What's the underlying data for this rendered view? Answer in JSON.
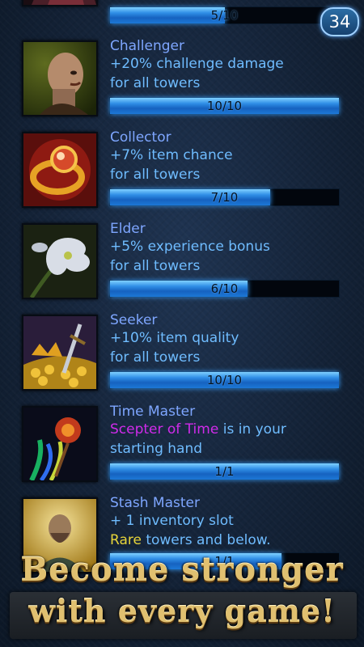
{
  "level_badge": "34",
  "talents": [
    {
      "id": "previous",
      "icon": "dark-tower-icon",
      "progress": {
        "label": "5/10",
        "current": 5,
        "max": 10
      }
    },
    {
      "id": "challenger",
      "icon": "bald-warrior-portrait-icon",
      "name": "Challenger",
      "desc": [
        "+20% challenge damage",
        "for all towers"
      ],
      "progress": {
        "label": "10/10",
        "current": 10,
        "max": 10
      }
    },
    {
      "id": "collector",
      "icon": "gold-ring-icon",
      "name": "Collector",
      "desc": [
        "+7% item chance",
        "for all towers"
      ],
      "progress": {
        "label": "7/10",
        "current": 7,
        "max": 10
      }
    },
    {
      "id": "elder",
      "icon": "white-flowers-icon",
      "name": "Elder",
      "desc": [
        "+5% experience bonus",
        "for all towers"
      ],
      "progress": {
        "label": "6/10",
        "current": 6,
        "max": 10
      }
    },
    {
      "id": "seeker",
      "icon": "treasure-sword-icon",
      "name": "Seeker",
      "desc": [
        "+10% item quality",
        "for all towers"
      ],
      "progress": {
        "label": "10/10",
        "current": 10,
        "max": 10
      }
    },
    {
      "id": "time_master",
      "icon": "scepter-icon",
      "name": "Time Master",
      "desc_highlight": "Scepter of Time",
      "desc_rest": " is in your",
      "desc_line2": "starting hand",
      "progress": {
        "label": "1/1",
        "current": 1,
        "max": 1
      }
    },
    {
      "id": "stash_master",
      "icon": "bearded-merchant-portrait-icon",
      "name": "Stash Master",
      "desc_line1": "+ 1 inventory slot",
      "desc_highlight": "Rare",
      "desc_rest": " towers and below.",
      "progress": {
        "label": "1/1",
        "current": 0.75,
        "max": 1
      }
    }
  ],
  "banner": {
    "line1": "Become stronger",
    "line2": "with every game!"
  },
  "colors": {
    "name": "#7ea6ff",
    "desc": "#6fbcff",
    "purple_highlight": "#d02bea",
    "yellow_highlight": "#e6d43a",
    "banner_gold": "#e0c070"
  }
}
